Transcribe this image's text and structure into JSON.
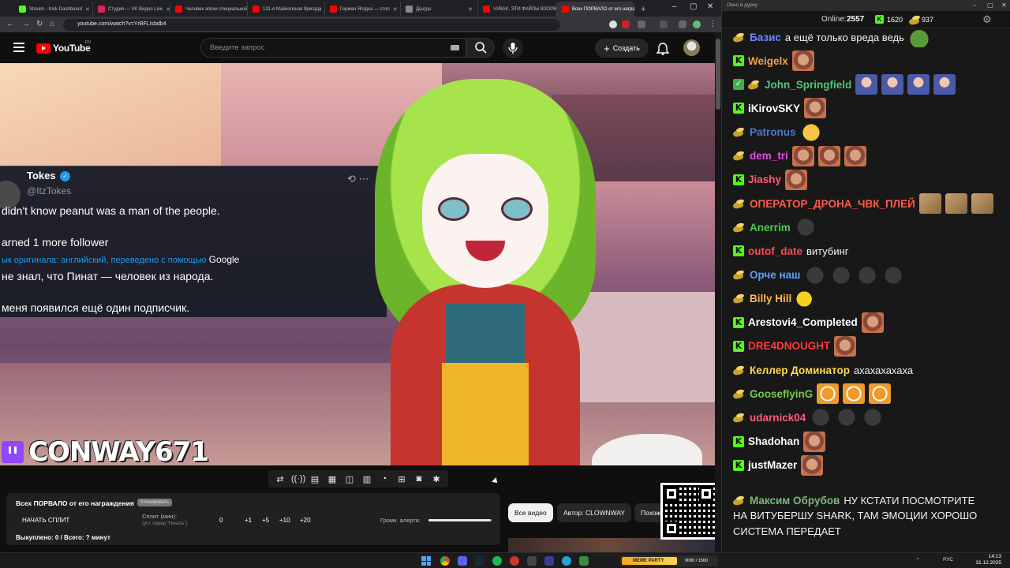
{
  "browser": {
    "tabs": [
      {
        "label": "Stream - Kick Dashboard",
        "icon": "kick-favicon",
        "color": "#53fc18"
      },
      {
        "label": "Студия — VK Видео Live",
        "icon": "vk-favicon",
        "color": "#e0245e"
      },
      {
        "label": "Человек эпохи специальной",
        "icon": "youtube-favicon",
        "color": "#ff0000"
      },
      {
        "label": "131-я Майкопская бригада",
        "icon": "youtube-favicon",
        "color": "#ff0000"
      },
      {
        "label": "Герман Ягодка — стоп",
        "icon": "youtube-favicon",
        "color": "#ff0000"
      },
      {
        "label": "Д(ы)ра",
        "icon": "page-favicon",
        "color": "#888888"
      },
      {
        "label": "ЧУВАК, ЭТИ ФАЙЛЫ ВЗОРВУТ",
        "icon": "youtube-favicon",
        "color": "#ff0000"
      },
      {
        "label": "Всех ПОРВАЛО от его награждения",
        "icon": "youtube-favicon",
        "color": "#ff0000"
      }
    ],
    "url": "youtube.com/watch?v=YrBFLIsbdb4"
  },
  "youtube": {
    "logo": "YouTube",
    "region": "RU",
    "search_placeholder": "Введите запрос",
    "create_label": "Создать",
    "chips": [
      "Все видео",
      "Автор: CLOWNWAY",
      "Похожие"
    ]
  },
  "video": {
    "tweet": {
      "name": "Tokes",
      "handle": "@ItzTokes",
      "line1": "didn't know peanut was a man of the people.",
      "line2": "arned 1 more follower",
      "translation_note": "ык оригинала: английский, переведено с помощью",
      "translation_brand": "Google",
      "line3": "не знал, что Пинат — человек из народа.",
      "line4": "меня появился ещё один подписчик."
    },
    "overlay_name": "CONWAY671"
  },
  "alert_panel": {
    "title": "Всех ПОРВАЛО от его награждения",
    "badge": "Клонировать",
    "start_split": "НАЧАТЬ СПЛИТ",
    "split_label": "Сплит (мин):",
    "split_sub": "(уст. перед \"Начать\")",
    "split_value": "0",
    "steps": [
      "+1",
      "+5",
      "+10",
      "+20"
    ],
    "volume_label": "Громк. алерта:",
    "volume": 0.98,
    "status": "Выкуплено: 0 / Всего: ? минут"
  },
  "chat": {
    "window_title": "Окно в дурку",
    "online_label": "Online:",
    "online_value": "2557",
    "kick_count": "1620",
    "other_count": "937",
    "messages": [
      {
        "platform": "goose",
        "user": "Базис",
        "color": "#6b8cff",
        "text": "а ещё только вреда ведь",
        "emotes": [
          "frog"
        ]
      },
      {
        "platform": "kick",
        "user": "Weigelx",
        "color": "#f0a050",
        "text": "",
        "emotes": [
          "face"
        ]
      },
      {
        "platform": "goose",
        "mod": true,
        "user": "John_Springfield",
        "color": "#50c878",
        "text": "",
        "emotes": [
          "blue",
          "blue",
          "blue",
          "blue"
        ]
      },
      {
        "platform": "kick",
        "user": "iKirovSKY",
        "color": "#ffffff",
        "text": "",
        "emotes": [
          "face"
        ]
      },
      {
        "platform": "goose",
        "user": "Patronus",
        "color": "#4a7ad0",
        "text": "",
        "emotes": [
          "cry"
        ]
      },
      {
        "platform": "goose",
        "user": "dem_tri",
        "color": "#e050e0",
        "text": "",
        "emotes": [
          "face",
          "face",
          "face"
        ]
      },
      {
        "platform": "kick",
        "user": "Jiashy",
        "color": "#ff5a7a",
        "text": "",
        "emotes": [
          "face"
        ]
      },
      {
        "platform": "goose",
        "user": "ОПЕРАТОР_ДРОНА_ЧВК_ПЛЕЙ",
        "color": "#ff5a4a",
        "text": "",
        "emotes": [
          "tan",
          "tan",
          "tan"
        ]
      },
      {
        "platform": "goose",
        "user": "Anerrim",
        "color": "#50c850",
        "text": "",
        "emotes": [
          "dark"
        ]
      },
      {
        "platform": "kick",
        "user": "outof_date",
        "color": "#ff4a4a",
        "text": "витубинг",
        "emotes": []
      },
      {
        "platform": "goose",
        "user": "Орче наш",
        "color": "#5aa0ff",
        "text": "",
        "emotes": [
          "dark",
          "dark",
          "dark",
          "dark"
        ]
      },
      {
        "platform": "goose",
        "user": "Billy Hill",
        "color": "#ffb84a",
        "text": "",
        "emotes": [
          "yellow"
        ]
      },
      {
        "platform": "kick",
        "user": "Arestovi4_Completed",
        "color": "#ffffff",
        "text": "",
        "emotes": [
          "face"
        ]
      },
      {
        "platform": "kick",
        "user": "DRE4DNOUGHT",
        "color": "#ff3a3a",
        "text": "",
        "emotes": [
          "face"
        ]
      },
      {
        "platform": "goose",
        "user": "Келлер Доминатор",
        "color": "#ffd84a",
        "text": "ахахахахаха",
        "emotes": []
      },
      {
        "platform": "goose",
        "user": "GooseflyinG",
        "color": "#7acb4a",
        "text": "",
        "emotes": [
          "tiger",
          "tiger",
          "tiger"
        ]
      },
      {
        "platform": "goose",
        "user": "udarnick04",
        "color": "#ff5a7a",
        "text": "",
        "emotes": [
          "dark",
          "dark",
          "dark"
        ]
      },
      {
        "platform": "kick",
        "user": "Shadohan",
        "color": "#ffffff",
        "text": "",
        "emotes": [
          "face"
        ]
      },
      {
        "platform": "kick",
        "user": "justMazer",
        "color": "#ffffff",
        "text": "",
        "emotes": [
          "face"
        ]
      }
    ],
    "last_message": {
      "platform": "goose",
      "user": "Максим Обрубов",
      "color": "#7ab87a",
      "text_first": "НУ КСТАТИ ПОСМОТРИТЕ",
      "text_rest1": "НА ВИТУБЕРШУ SHARK, ТАМ ЭМОЦИИ ХОРОШО",
      "text_rest2": "СИСТЕМА ПЕРЕДАЕТ"
    }
  },
  "taskbar": {
    "widget_label": "MEME PARTY",
    "widget_progress": "0000 / 1500",
    "lang": "РУС",
    "time": "14:13",
    "date": "31.12.2025"
  }
}
